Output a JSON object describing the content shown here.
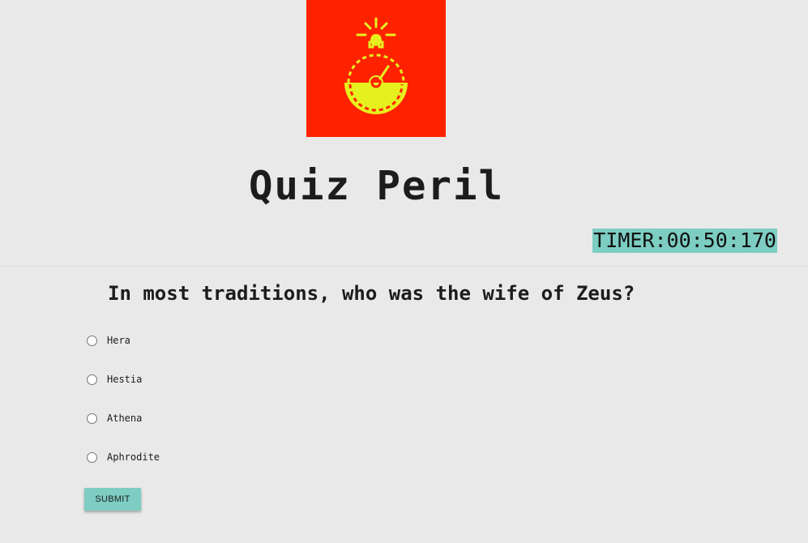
{
  "app": {
    "title": "Quiz Peril",
    "logo_icon": "stopwatch-alarm-icon",
    "logo_bg_color": "#ff2200",
    "logo_fg_color": "#e6f01e"
  },
  "timer": {
    "text": "TIMER:00:50:170",
    "bg_color": "#7dcdc2"
  },
  "question": {
    "text": "In most traditions, who was the wife of Zeus?",
    "options": [
      {
        "label": "Hera"
      },
      {
        "label": "Hestia"
      },
      {
        "label": "Athena"
      },
      {
        "label": "Aphrodite"
      }
    ]
  },
  "submit": {
    "label": "SUBMIT",
    "bg_color": "#7dcdc2"
  }
}
